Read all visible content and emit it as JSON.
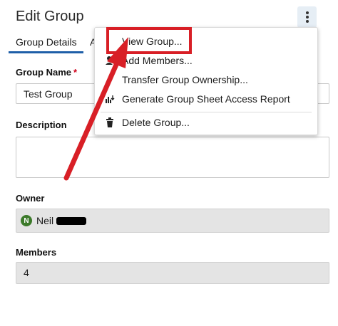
{
  "header": {
    "title": "Edit Group",
    "menu_icon": "vertical-ellipsis-icon"
  },
  "tabs": [
    {
      "label": "Group Details",
      "active": true
    },
    {
      "label": "A",
      "active": false
    }
  ],
  "form": {
    "group_name": {
      "label": "Group Name",
      "required_marker": "*",
      "value": "Test Group"
    },
    "description": {
      "label": "Description",
      "value": ""
    },
    "owner": {
      "label": "Owner",
      "avatar_initial": "N",
      "name": "Neil"
    },
    "members": {
      "label": "Members",
      "value": "4"
    }
  },
  "menu": {
    "items": [
      {
        "label": "View Group...",
        "icon": ""
      },
      {
        "label": "Add Members...",
        "icon": "add-user-icon"
      },
      {
        "label": "Transfer Group Ownership...",
        "icon": ""
      },
      {
        "label": "Generate Group Sheet Access Report",
        "icon": "report-download-icon"
      },
      {
        "label": "Delete Group...",
        "icon": "trash-icon"
      }
    ]
  },
  "colors": {
    "accent": "#1f5fa8",
    "annotation_red": "#d81f26",
    "avatar": "#3c7a2a",
    "required": "#d0021b"
  }
}
